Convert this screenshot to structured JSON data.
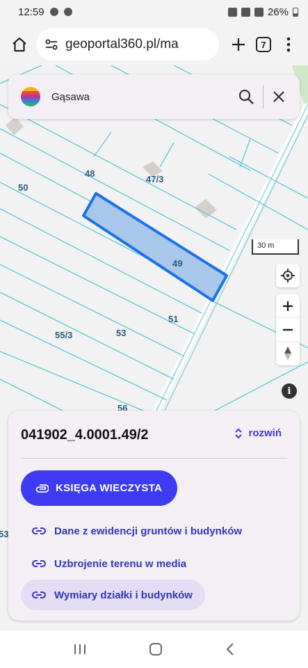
{
  "status_bar": {
    "time": "12:59",
    "battery": "26%"
  },
  "browser": {
    "url": "geoportal360.pl/ma",
    "tab_count": "7"
  },
  "search": {
    "value": "Gąsawa"
  },
  "map": {
    "parcel_labels": [
      "48",
      "50",
      "47/3",
      "49",
      "51",
      "55/3",
      "53",
      "56",
      "53"
    ],
    "scale_label": "30 m"
  },
  "panel": {
    "parcel_id": "041902_4.0001.49/2",
    "expand_label": "rozwiń",
    "primary_button": "KSIĘGA WIECZYSTA",
    "links": [
      "Dane z ewidencji gruntów i budynków",
      "Uzbrojenie terenu w media",
      "Wymiary działki i budynków"
    ]
  },
  "colors": {
    "accent": "#3d3bf3",
    "link": "#3434b8",
    "parcel_fill": "#a9c7e8",
    "parcel_stroke": "#1a73e8",
    "cadastral_line": "#5fc8d8"
  }
}
